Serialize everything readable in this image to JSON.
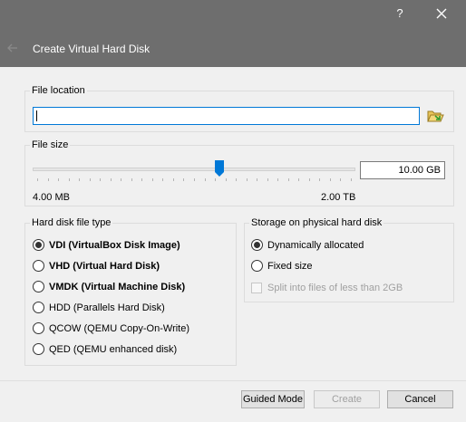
{
  "window": {
    "help_label": "?",
    "title": "Create Virtual Hard Disk"
  },
  "file_location": {
    "group_label": "File location",
    "value": ""
  },
  "file_size": {
    "group_label": "File size",
    "min_label": "4.00 MB",
    "max_label": "2.00 TB",
    "value": "10.00 GB",
    "slider_position": 0.58
  },
  "disk_type": {
    "group_label": "Hard disk file type",
    "options": [
      {
        "label": "VDI (VirtualBox Disk Image)",
        "checked": true
      },
      {
        "label": "VHD (Virtual Hard Disk)",
        "checked": false
      },
      {
        "label": "VMDK (Virtual Machine Disk)",
        "checked": false
      },
      {
        "label": "HDD (Parallels Hard Disk)",
        "checked": false
      },
      {
        "label": "QCOW (QEMU Copy-On-Write)",
        "checked": false
      },
      {
        "label": "QED (QEMU enhanced disk)",
        "checked": false
      }
    ]
  },
  "storage": {
    "group_label": "Storage on physical hard disk",
    "options": [
      {
        "label": "Dynamically allocated",
        "checked": true
      },
      {
        "label": "Fixed size",
        "checked": false
      }
    ],
    "split_label": "Split into files of less than 2GB",
    "split_checked": false
  },
  "buttons": {
    "guided_mode": "Guided Mode",
    "create": "Create",
    "cancel": "Cancel"
  },
  "colors": {
    "titlebar": "#6e6e6e",
    "accent": "#0078d7"
  }
}
